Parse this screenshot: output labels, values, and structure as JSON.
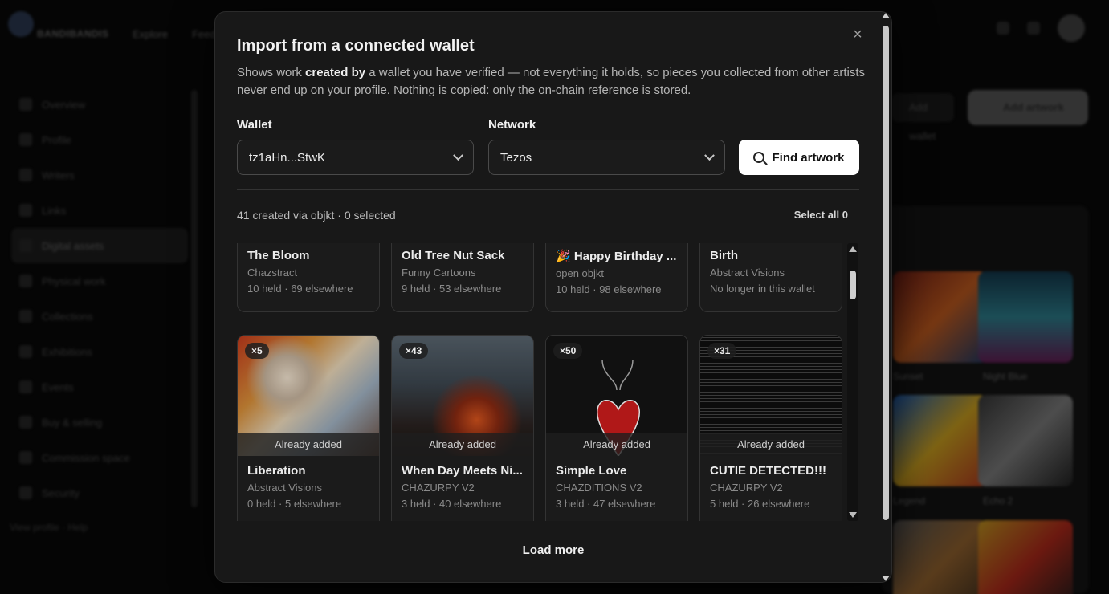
{
  "modal": {
    "title": "Import from a connected wallet",
    "desc_before": "Shows work ",
    "desc_bold": "created by",
    "desc_after": " a wallet you have verified — not everything it holds, so pieces you collected from other artists never end up on your profile. Nothing is copied: only the on-chain reference is stored.",
    "close_glyph": "×",
    "wallet_label": "Wallet",
    "wallet_value": "tz1aHn...StwK",
    "network_label": "Network",
    "network_value": "Tezos",
    "find_label": "Find artwork",
    "count_text": "41 created via objkt · 0 selected",
    "select_all": "Select all 0",
    "load_more": "Load more"
  },
  "cards_top": [
    {
      "title": "The Bloom",
      "subtitle": "Chazstract",
      "held": "10 held · 69 elsewhere"
    },
    {
      "title": "Old Tree Nut Sack",
      "subtitle": "Funny Cartoons",
      "held": "9 held · 53 elsewhere"
    },
    {
      "title": "🎉 Happy Birthday ...",
      "subtitle": "open objkt",
      "held": "10 held · 98 elsewhere"
    },
    {
      "title": "Birth",
      "subtitle": "Abstract Visions",
      "held": "No longer in this wallet"
    }
  ],
  "cards_bottom": [
    {
      "title": "Liberation",
      "subtitle": "Abstract Visions",
      "held": "0 held · 5 elsewhere",
      "badge": "×5",
      "status": "Already added"
    },
    {
      "title": "When Day Meets Ni...",
      "subtitle": "CHAZURPY V2",
      "held": "3 held · 40 elsewhere",
      "badge": "×43",
      "status": "Already added"
    },
    {
      "title": "Simple Love",
      "subtitle": "CHAZDITIONS V2",
      "held": "3 held · 47 elsewhere",
      "badge": "×50",
      "status": "Already added"
    },
    {
      "title": "CUTIE DETECTED!!!",
      "subtitle": "CHAZURPY V2",
      "held": "5 held · 26 elsewhere",
      "badge": "×31",
      "status": "Already added"
    }
  ],
  "background": {
    "brand": "BANDIBANDIS",
    "topnav": [
      "Explore",
      "Feed"
    ],
    "sidebar": [
      "Overview",
      "Profile",
      "Writers",
      "Links",
      "Digital assets",
      "Physical work",
      "Collections",
      "Exhibitions",
      "Events",
      "Buy & selling",
      "Commission space",
      "Security"
    ],
    "sidebar_footer": "View profile · Help",
    "btn_secondary": "Add wallet",
    "btn_primary": "Add artwork",
    "panel_captions": [
      "Sunset",
      "Night Blue",
      "Legend",
      "Echo 2"
    ]
  }
}
